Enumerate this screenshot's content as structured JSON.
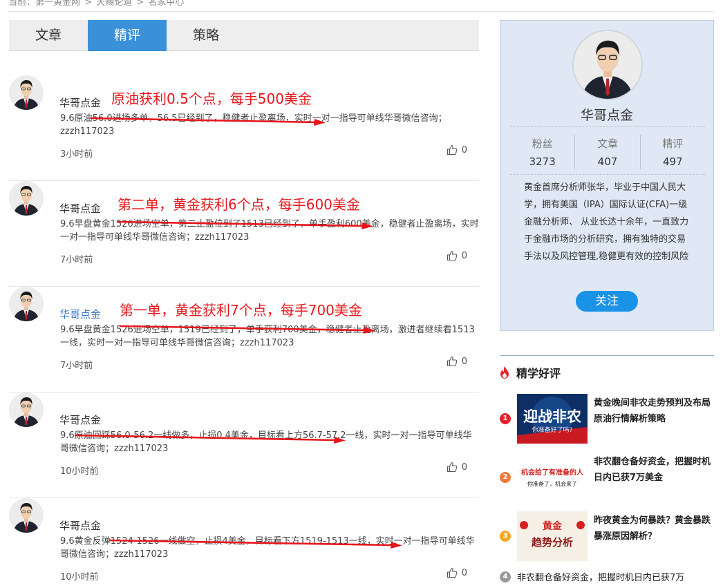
{
  "breadcrumb": {
    "items": [
      "当前：第一黄金网",
      "天赐论道",
      "名家中心"
    ],
    "sep": ">"
  },
  "tabs": [
    {
      "label": "文章",
      "active": false
    },
    {
      "label": "精评",
      "active": true
    },
    {
      "label": "策略",
      "active": false
    }
  ],
  "posts": [
    {
      "author": "华哥点金",
      "headline": "原油获利0.5个点，每手500美金",
      "body": "9.6原油56.0进场多单，56.5已经到了，稳健者止盈离场，实时一对一指导可单线华哥微信咨询；zzzh117023",
      "time": "3小时前",
      "likes": "0"
    },
    {
      "author": "华哥点金",
      "headline": "第二单，黄金获利6个点，每手600美金",
      "body": "9.6早盘黄金1526进场空单，第二止盈位到了1513已经到了，单手盈利600美金，稳健者止盈离场，实时一对一指导可单线华哥微信咨询；zzzh117023",
      "time": "7小时前",
      "likes": "0"
    },
    {
      "author": "华哥点金",
      "headline": "第一单，黄金获利7个点，每手700美金",
      "body": "9.6早盘黄金1526进场空单，1519已经到了，单手获利700美金，稳健者止盈离场，激进者继续看1513一线，实时一对一指导可单线华哥微信咨询；zzzh117023",
      "time": "7小时前",
      "likes": "0"
    },
    {
      "author": "华哥点金",
      "headline": "",
      "body": "9.6原油回踩56.0-56.2一线做多，止损0.4美金，目标看上方56.7-57.2一线，实时一对一指导可单线华哥微信咨询；zzzh117023",
      "time": "10小时前",
      "likes": "0"
    },
    {
      "author": "华哥点金",
      "headline": "",
      "body": "9.6黄金反弹1524-1526一线做空，止损4美金，目标看下方1519-1513一线，实时一对一指导可单线华哥微信咨询；zzzh117023",
      "time": "10小时前",
      "likes": "0"
    }
  ],
  "profile": {
    "name": "华哥点金",
    "stats": [
      {
        "label": "粉丝",
        "value": "3273"
      },
      {
        "label": "文章",
        "value": "407"
      },
      {
        "label": "精评",
        "value": "497"
      }
    ],
    "bio": "黄金首席分析师张华，毕业于中国人民大学，拥有美国（IPA）国际认证(CFA)一级金融分析师、 从业长达十余年，一直致力于金融市场的分析研究，拥有独特的交易手法以及风控管理,稳健更有效的控制风险",
    "follow_label": "关注"
  },
  "hot": {
    "title": "精学好评",
    "items": [
      {
        "num": "1",
        "title": "黄金晚间非农走势预判及布局原油行情解析策略",
        "color": "#e8232a",
        "thumb_text": [
          "迎战非农",
          "你准备好了吗?"
        ]
      },
      {
        "num": "2",
        "title": "非农翻仓备好资金，把握时机日内已获7万美金",
        "color": "#f0793b",
        "thumb_text": [
          "机会给了有准备的人",
          "你准备了，机会来了"
        ]
      },
      {
        "num": "3",
        "title": "昨夜黄金为何暴跌？黄金暴跌暴涨原因解析？",
        "color": "#f5a623",
        "thumb_text": [
          "黄金",
          "趋势分析"
        ]
      },
      {
        "num": "4",
        "title": "非农翻仓备好资金，把握时机日内已获7万",
        "color": "#999999"
      }
    ]
  },
  "colors": {
    "accent": "#3a90d9",
    "headline_red": "#e8161b",
    "follow_blue": "#1a93e6",
    "profile_bg": "#dfe8f4"
  }
}
